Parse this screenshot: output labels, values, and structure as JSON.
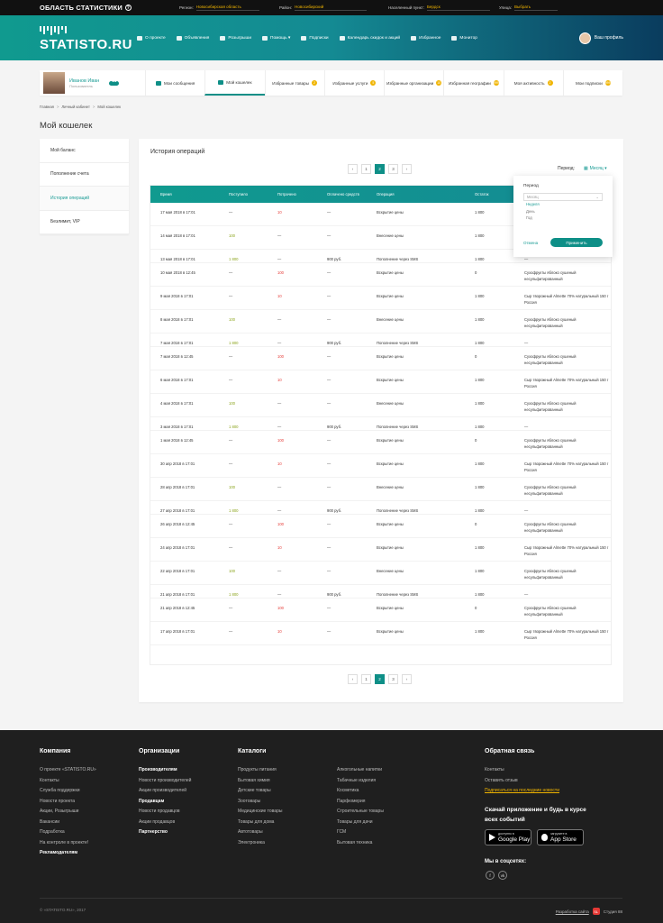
{
  "topbar": {
    "brand": "ОБЛАСТЬ СТАТИСТИКИ",
    "region_label": "Регион:",
    "region_value": "Новосибирская область",
    "district_label": "Район:",
    "district_value": "Новосибирский",
    "city_label": "Населенный пункт:",
    "city_value": "Бердск",
    "street_label": "Улица:",
    "street_value": "Выбрать"
  },
  "header": {
    "logo": "STATISTO.RU",
    "nav": [
      "О проекте",
      "Объявления",
      "Розыгрыши",
      "Помощь ▾",
      "Подписки",
      "Календарь скидок и акций",
      "Избранное",
      "Монитор"
    ],
    "profile": "Ваш профиль",
    "profile_badge": "3"
  },
  "userbar": {
    "name": "Иванов Иван",
    "role": "Пользователь",
    "dots": "•••",
    "tabs": [
      {
        "label": "Мои сообщения",
        "badge": "2"
      },
      {
        "label": "Мой кошелек",
        "badge": ""
      },
      {
        "label": "Избранные товары",
        "badge": "2"
      },
      {
        "label": "Избранные услуги",
        "badge": "5"
      },
      {
        "label": "Избранные организации",
        "badge": "10"
      },
      {
        "label": "Избранная географии",
        "badge": "999"
      },
      {
        "label": "Моя активность",
        "badge": "2"
      },
      {
        "label": "Мои подписки",
        "badge": "999"
      }
    ]
  },
  "breadcrumbs": [
    "Главная",
    "Личный кабинет",
    "Мой кошелек"
  ],
  "page_title": "Мой кошелек",
  "sidebar": [
    "Мой баланс",
    "Пополнение счета",
    "История операций",
    "Безлимит, VIP"
  ],
  "main": {
    "title": "История операций",
    "pages": [
      "‹",
      "1",
      "2",
      "3",
      "›"
    ],
    "period_label": "Период:",
    "period_value": "Месяц ▾"
  },
  "table": {
    "headers": [
      "Время",
      "Поступило",
      "Потрачено",
      "Оплачено средств",
      "Операция",
      "Остаток",
      ""
    ],
    "rows": [
      [
        "17 мая 2018 в 17:01",
        "—",
        "10",
        "—",
        "Вскрытие цены",
        "1 800",
        ""
      ],
      [
        "14 мая 2018 в 17:01",
        "100",
        "—",
        "—",
        "Внесение цены",
        "1 800",
        ""
      ],
      [
        "13 мая 2018 в 17:01",
        "1 800",
        "—",
        "900 руб.",
        "Пополнение через SMS",
        "1 800",
        "—"
      ],
      [
        "10 мая 2018 в 12:45",
        "—",
        "100",
        "—",
        "Вскрытие цены",
        "0",
        "Сухофрукты яблоко сушеный несульфитированный"
      ],
      [
        "9 мая 2018 в 17:01",
        "—",
        "10",
        "—",
        "Вскрытие цены",
        "1 800",
        "Сыр творожный Almette 70% натуральный 150 г Россия"
      ],
      [
        "8 мая 2018 в 17:01",
        "100",
        "—",
        "—",
        "Внесение цены",
        "1 800",
        "Сухофрукты яблоко сушеный несульфитированный"
      ],
      [
        "7 мая 2018 в 17:01",
        "1 800",
        "—",
        "900 руб.",
        "Пополнение через SMS",
        "1 800",
        "—"
      ],
      [
        "7 мая 2018 в 12:45",
        "—",
        "100",
        "—",
        "Вскрытие цены",
        "0",
        "Сухофрукты яблоко сушеный несульфитированный"
      ],
      [
        "6 мая 2018 в 17:01",
        "—",
        "10",
        "—",
        "Вскрытие цены",
        "1 800",
        "Сыр творожный Almette 70% натуральный 150 г Россия"
      ],
      [
        "4 мая 2018 в 17:01",
        "100",
        "—",
        "—",
        "Внесение цены",
        "1 800",
        "Сухофрукты яблоко сушеный несульфитированный"
      ],
      [
        "3 мая 2018 в 17:01",
        "1 800",
        "—",
        "900 руб.",
        "Пополнение через SMS",
        "1 800",
        "—"
      ],
      [
        "1 мая 2018 в 12:45",
        "—",
        "100",
        "—",
        "Вскрытие цены",
        "0",
        "Сухофрукты яблоко сушеный несульфитированный"
      ],
      [
        "30 апр 2018 в 17:01",
        "—",
        "10",
        "—",
        "Вскрытие цены",
        "1 800",
        "Сыр творожный Almette 70% натуральный 150 г Россия"
      ],
      [
        "28 апр 2018 в 17:01",
        "100",
        "—",
        "—",
        "Внесение цены",
        "1 800",
        "Сухофрукты яблоко сушеный несульфитированный"
      ],
      [
        "27 апр 2018 в 17:01",
        "1 800",
        "—",
        "900 руб.",
        "Пополнение через SMS",
        "1 800",
        "—"
      ],
      [
        "26 апр 2018 в 12:45",
        "—",
        "100",
        "—",
        "Вскрытие цены",
        "0",
        "Сухофрукты яблоко сушеный несульфитированный"
      ],
      [
        "24 апр 2018 в 17:01",
        "—",
        "10",
        "—",
        "Вскрытие цены",
        "1 800",
        "Сыр творожный Almette 70% натуральный 150 г Россия"
      ],
      [
        "22 апр 2018 в 17:01",
        "100",
        "—",
        "—",
        "Внесение цены",
        "1 800",
        "Сухофрукты яблоко сушеный несульфитированный"
      ],
      [
        "21 апр 2018 в 17:01",
        "1 800",
        "—",
        "900 руб.",
        "Пополнение через SMS",
        "1 800",
        "—"
      ],
      [
        "21 апр 2018 в 12:45",
        "—",
        "100",
        "—",
        "Вскрытие цены",
        "0",
        "Сухофрукты яблоко сушеный несульфитированный"
      ],
      [
        "17 апр 2018 в 17:01",
        "—",
        "10",
        "—",
        "Вскрытие цены",
        "1 800",
        "Сыр творожный Almette 70% натуральный 150 г Россия"
      ]
    ]
  },
  "popup": {
    "label": "Период",
    "select": "Месяц",
    "options": [
      "Неделя",
      "День",
      "Год"
    ],
    "cancel": "Отмена",
    "apply": "Применить"
  },
  "footer": {
    "col1": {
      "title": "Компания",
      "links": [
        "О проекте «STATISTO.RU»",
        "Контакты",
        "Служба поддержки",
        "Новости проекта",
        "Акции, Розыгрыши",
        "Вакансии",
        "Подработка",
        "На контроле в проекте!",
        "Рекламодателям"
      ]
    },
    "col2": {
      "title": "Организации",
      "links": [
        "Производителям",
        "Новости производителей",
        "Акции производителей",
        "Продавцам",
        "Новости продавцов",
        "Акции продавцов",
        "Партнерство"
      ]
    },
    "col3": {
      "title": "Каталоги",
      "links": [
        "Продукты питания",
        "Бытовая химия",
        "Детские товары",
        "Зоотовары",
        "Медицинские товары",
        "Товары для дома",
        "Автотовары",
        "Электроника"
      ]
    },
    "col4": {
      "links": [
        "Алкогольные напитки",
        "Табачные изделия",
        "Косметика",
        "Парфюмерия",
        "Строительные товары",
        "Товары для дачи",
        "ГСМ",
        "Бытовая техника"
      ]
    },
    "col5": {
      "title": "Обратная связь",
      "links": [
        "Контакты",
        "Оставить отзыв",
        "Подписаться на последние новости"
      ]
    },
    "app_title": "Скачай приложение и будь в курсе всех событий",
    "gplay_small": "доступно в",
    "gplay_big": "Google Play",
    "appstore_small": "загрузите в",
    "appstore_big": "App Store",
    "social_title": "Мы в соцсетях:",
    "social": [
      "f",
      "vk"
    ],
    "copyright": "© «STATISTO.RU», 2017",
    "dev_link": "Разработка сайта",
    "dev_logo": "SL",
    "dev_name": "Студия 88"
  }
}
